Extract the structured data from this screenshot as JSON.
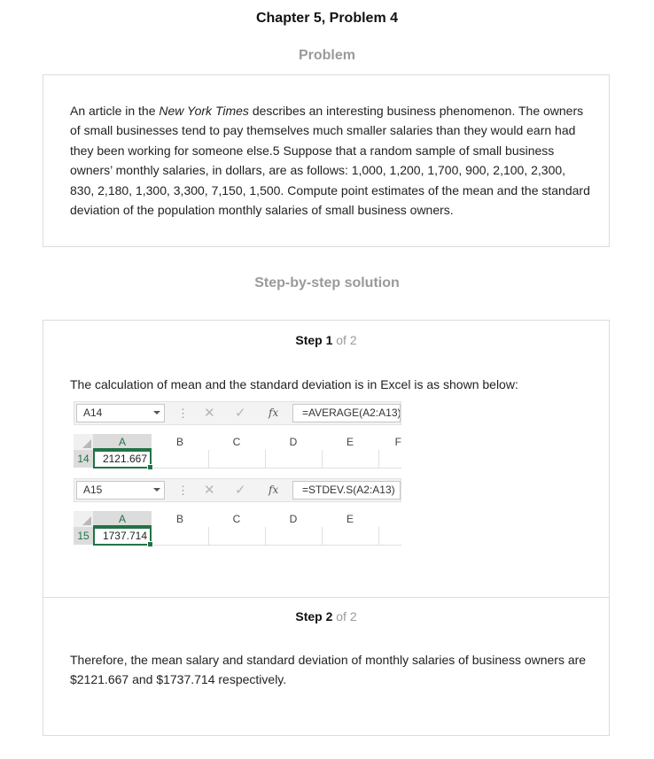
{
  "page": {
    "title": "Chapter 5, Problem 4",
    "problem_heading": "Problem",
    "solution_heading": "Step-by-step solution"
  },
  "problem": {
    "text_before": "An article in the ",
    "text_italic": "New York Times",
    "text_after": " describes an interesting business phenomenon. The owners of small businesses tend to pay themselves much smaller salaries than they would earn had they been working for someone else.5 Suppose that a random sample of small business owners’ monthly salaries, in dollars, are as follows: 1,000, 1,200, 1,700, 900, 2,100, 2,300, 830, 2,180, 1,300, 3,300, 7,150, 1,500. Compute point estimates of the mean and the standard deviation of the population monthly salaries of small business owners."
  },
  "steps": [
    {
      "label": "Step 1",
      "of": "of 2",
      "text": "The calculation of mean and the standard deviation is in Excel is as shown below:",
      "excel": [
        {
          "namebox": "A14",
          "formula": "=AVERAGE(A2:A13)",
          "row": "14",
          "value": "2121.667",
          "columns": [
            "A",
            "B",
            "C",
            "D",
            "E",
            "F"
          ]
        },
        {
          "namebox": "A15",
          "formula": "=STDEV.S(A2:A13)",
          "row": "15",
          "value": "1737.714",
          "columns": [
            "A",
            "B",
            "C",
            "D",
            "E"
          ]
        }
      ]
    },
    {
      "label": "Step 2",
      "of": "of 2",
      "text": "Therefore, the mean salary and standard deviation of monthly salaries of business owners are $2121.667 and $1737.714 respectively."
    }
  ],
  "excel_ui": {
    "vdots": "⋮",
    "cancel": "✕",
    "enter": "✓",
    "fx": "fx"
  }
}
